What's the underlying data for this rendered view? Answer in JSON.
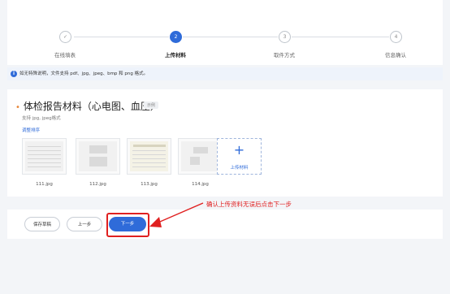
{
  "steps": [
    {
      "label": "在线填表",
      "number": "✓",
      "state": "done"
    },
    {
      "label": "上传材料",
      "number": "2",
      "state": "active"
    },
    {
      "label": "取件方式",
      "number": "3",
      "state": "pending"
    },
    {
      "label": "信息确认",
      "number": "4",
      "state": "pending"
    }
  ],
  "notice": {
    "icon": "info-icon",
    "text": "如无特殊说明，文件支持 pdf、jpg、jpeg、bmp 和 png 格式。"
  },
  "materials": {
    "title": "体检报告材料（心电图、血压）",
    "badge": "示例",
    "support_text": "支持 jpg, jpeg格式",
    "reorder_label": "调整排序",
    "files": [
      {
        "name": "111.jpg"
      },
      {
        "name": "112.jpg"
      },
      {
        "name": "113.jpg"
      },
      {
        "name": "114.jpg"
      }
    ],
    "upload_label": "上传材料",
    "upload_icon": "+"
  },
  "annotation": {
    "text": "确认上传资料无误后点击下一步",
    "color": "#e02020"
  },
  "footer": {
    "save_draft_label": "保存草稿",
    "prev_label": "上一步",
    "next_label": "下一步"
  },
  "colors": {
    "accent": "#2f6bd9",
    "annotation": "#e02020",
    "required_dot": "#e8873a"
  }
}
